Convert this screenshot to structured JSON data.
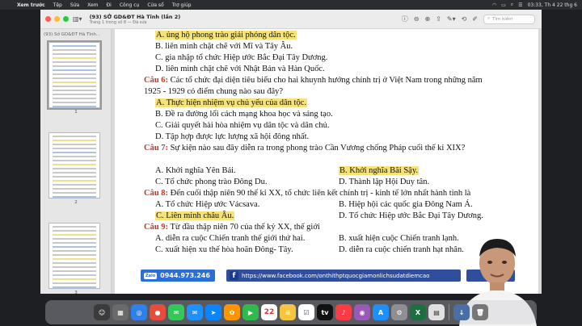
{
  "menubar": {
    "app_name": "Xem trước",
    "items": [
      "Tệp",
      "Sửa",
      "Xem",
      "Đi",
      "Công cụ",
      "Cửa sổ",
      "Trợ giúp"
    ],
    "clock": "03:33, Th 4 22 thg 6"
  },
  "toolbar": {
    "title": "(93) SỞ GD&ĐT Hà Tĩnh (lần 2)",
    "subtitle": "Trang 1 trong số 8 — Đã sửa",
    "search_placeholder": "Tìm kiếm"
  },
  "sidebar": {
    "header": "(93) Sở GD&ĐT Hà Tĩnh...",
    "pages": [
      "1",
      "2",
      "3"
    ]
  },
  "document": {
    "lines": [
      {
        "parts": [
          {
            "t": "A. ủng hộ phong trào giải phóng dân tộc.",
            "hl": true
          }
        ]
      },
      {
        "parts": [
          {
            "t": "B. liên minh chặt chẽ với Mĩ và Tây Âu."
          }
        ]
      },
      {
        "parts": [
          {
            "t": "C. gia nhập tổ chức Hiệp ước Bắc Đại Tây Dương."
          }
        ]
      },
      {
        "parts": [
          {
            "t": "D. liên minh chặt chẽ với Nhật Bản và Hàn Quốc."
          }
        ]
      },
      {
        "qn": "Câu 6:",
        "parts": [
          {
            "t": " Các tổ chức đại diện tiêu biểu cho hai khuynh hướng chính trị ở Việt Nam trong những năm"
          }
        ]
      },
      {
        "parts": [
          {
            "t": "1925 - 1929 có điểm chung nào sau đây?"
          }
        ]
      },
      {
        "parts": [
          {
            "t": "A. Thực hiện nhiệm vụ chủ yếu của dân tộc.",
            "hl": true
          }
        ]
      },
      {
        "parts": [
          {
            "t": "B. Đề ra đường lối cách mạng khoa học và sáng tạo."
          }
        ]
      },
      {
        "parts": [
          {
            "t": "C. Giải quyết hài hòa nhiệm vụ dân tộc và dân chủ."
          }
        ]
      },
      {
        "parts": [
          {
            "t": "D. Tập hợp được lực lượng xã hội đông nhất."
          }
        ]
      },
      {
        "qn": "Câu 7:",
        "parts": [
          {
            "t": " Sự kiện nào sau đây diễn ra trong phong trào Cần Vương chống Pháp cuối thế kỉ XIX?"
          }
        ]
      }
    ],
    "q7_opts": {
      "a": "A. Khởi nghĩa Yên Bái.",
      "b": "B. Khởi nghĩa Bãi Sậy.",
      "c": "C. Tổ chức phong trào Đông Du.",
      "d": "D. Thành lập Hội Duy tân."
    },
    "q8_qn": "Câu 8:",
    "q8_text": " Đến cuối thập niên 90 thế kỉ XX, tổ chức liên kết chính trị - kinh tế lớn nhất hành tinh là",
    "q8_opts": {
      "a": "A. Tổ chức Hiệp ước Vácsava.",
      "b": "B. Hiệp hội các quốc gia Đông Nam Á.",
      "c": "C. Liên minh châu Âu.",
      "d": "D. Tổ chức Hiệp ước Bắc Đại Tây Dương."
    },
    "q9_qn": "Câu 9:",
    "q9_text": " Từ đầu thập niên 70 của thế kỷ XX, thế giới",
    "q9_opts": {
      "a": "A. diễn ra cuộc Chiến tranh thế giới thứ hai.",
      "b": "B. xuất hiện cuộc Chiến tranh lạnh.",
      "c": "C. xuất hiện xu thế hòa hoãn Đông- Tây.",
      "d": "D. diễn ra cuộc chiến tranh hạt nhân."
    }
  },
  "banner": {
    "zalo_badge": "Zalo",
    "phone": "0944.973.246",
    "fb_icon": "f",
    "url": "https://www.facebook.com/onthithptquocgiamonlichsudatdiemcao",
    "page_number": "5"
  },
  "dock": {
    "calendar_day": "22"
  }
}
